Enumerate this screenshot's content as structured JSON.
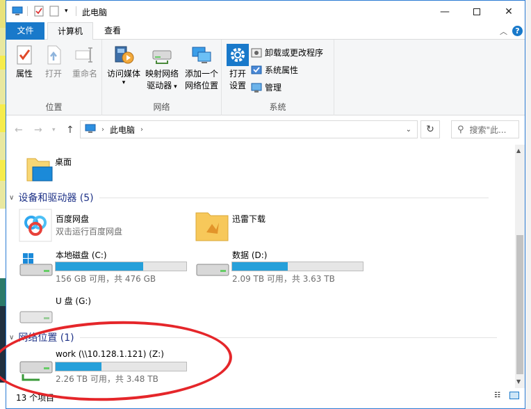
{
  "window": {
    "title": "此电脑"
  },
  "ribbon_tabs": {
    "file": "文件",
    "computer": "计算机",
    "view": "查看"
  },
  "ribbon": {
    "location_group": {
      "label": "位置",
      "properties": "属性",
      "open": "打开",
      "rename": "重命名"
    },
    "network_group": {
      "label": "网络",
      "access_media_line1": "访问媒体",
      "map_drive_line1": "映射网络",
      "map_drive_line2": "驱动器",
      "add_location_line1": "添加一个",
      "add_location_line2": "网络位置"
    },
    "system_group": {
      "label": "系统",
      "open_settings_line1": "打开",
      "open_settings_line2": "设置",
      "uninstall": "卸载或更改程序",
      "system_properties": "系统属性",
      "manage": "管理"
    }
  },
  "navigation": {
    "breadcrumb_item": "此电脑",
    "search_placeholder": "搜索\"此..."
  },
  "content": {
    "desktop": {
      "name": "桌面"
    },
    "devices_section": {
      "title": "设备和驱动器 (5)"
    },
    "baidu": {
      "name": "百度网盘",
      "sub": "双击运行百度网盘"
    },
    "xunlei": {
      "name": "迅雷下载"
    },
    "drive_c": {
      "name": "本地磁盘 (C:)",
      "sub": "156 GB 可用，共 476 GB",
      "used_fraction": 0.672
    },
    "drive_d": {
      "name": "数据 (D:)",
      "sub": "2.09 TB 可用，共 3.63 TB",
      "used_fraction": 0.424
    },
    "drive_g": {
      "name": "U 盘 (G:)"
    },
    "network_section": {
      "title": "网络位置 (1)"
    },
    "drive_z": {
      "name": "work (\\\\10.128.1.121) (Z:)",
      "sub": "2.26 TB 可用，共 3.48 TB",
      "used_fraction": 0.351
    }
  },
  "status": {
    "item_count": "13 个项目"
  },
  "colors": {
    "accent": "#1979ca",
    "bar_fill": "#26a0da",
    "annotation": "#e5262a",
    "section_title": "#1e3287"
  }
}
